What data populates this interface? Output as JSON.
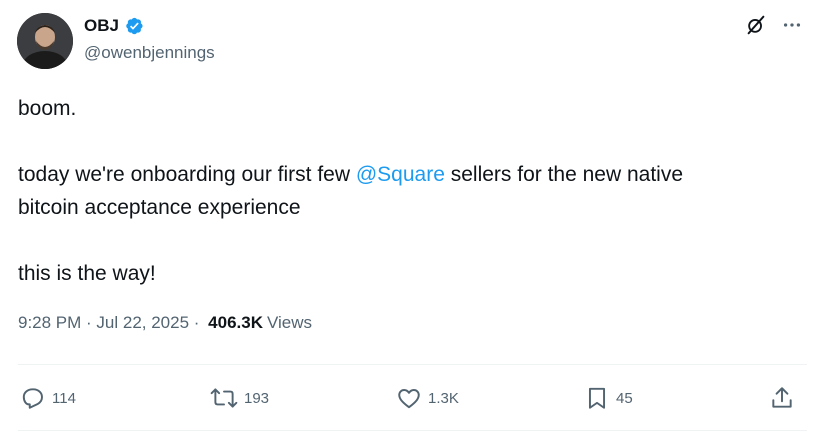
{
  "author": {
    "display_name": "OBJ",
    "handle": "@owenbjennings"
  },
  "icons": {
    "avatar": "avatar-photo",
    "verified": "verified-badge-icon",
    "grok": "grok-icon",
    "more": "more-icon"
  },
  "tweet": {
    "line1": "boom.",
    "line2_before": "today we're onboarding our first few ",
    "line2_mention": "@Square",
    "line2_after": " sellers for the new native",
    "line3": "bitcoin acceptance experience",
    "line4": "this is the way!"
  },
  "meta": {
    "timestamp": "9:28 PM · Jul 22, 2025 · ",
    "views_count": "406.3K",
    "views_label": "Views"
  },
  "actions": {
    "replies": "114",
    "reposts": "193",
    "likes": "1.3K",
    "bookmarks": "45"
  },
  "colors": {
    "accent": "#1d9bf0",
    "text": "#0f1419",
    "muted": "#536471"
  }
}
